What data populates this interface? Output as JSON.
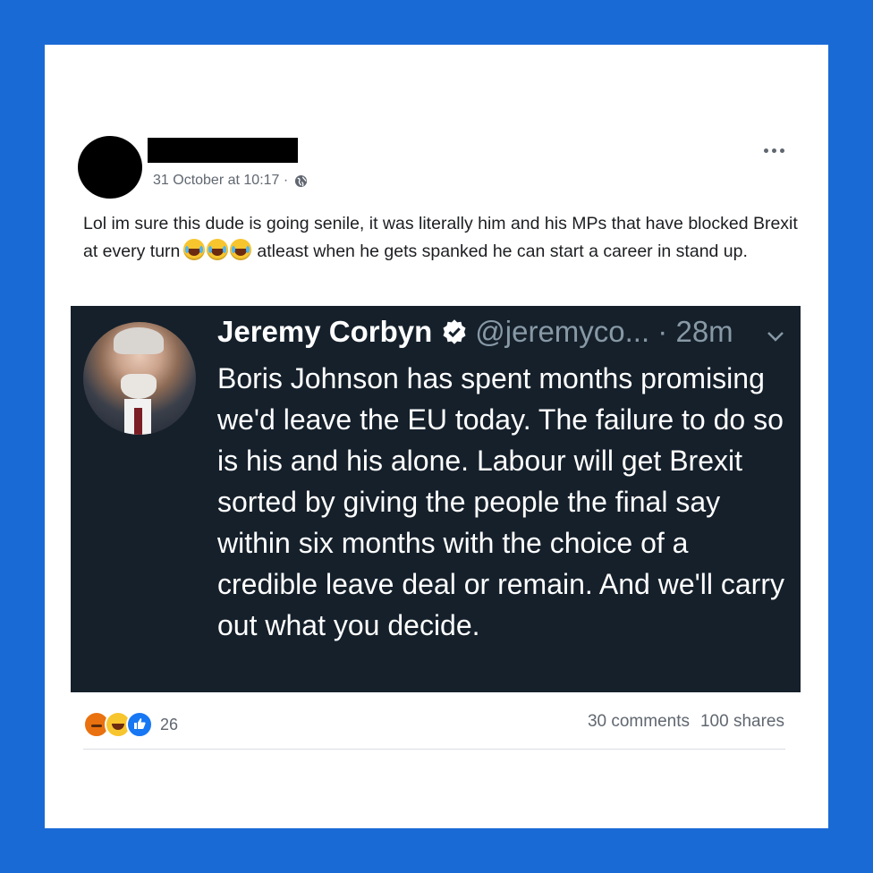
{
  "post": {
    "timestamp": "31 October at 10:17 ·",
    "text_part1": "Lol im sure this dude is going senile, it was literally him and his MPs that have blocked Brexit at every turn",
    "text_part2": "atleast when he gets spanked he can start a career in stand up.",
    "emoji_icons": [
      "face-with-tears-of-joy",
      "face-with-tears-of-joy",
      "face-with-tears-of-joy"
    ]
  },
  "tweet": {
    "name": "Jeremy Corbyn",
    "handle": "@jeremyco... · 28m",
    "body": "Boris Johnson has spent months promising we'd leave the EU today. The failure to do so is his and his alone. Labour will get Brexit sorted by giving the people the final say within six months with the choice of a credible leave deal or remain. And we'll carry out what you decide."
  },
  "footer": {
    "reaction_icons": [
      "angry-react",
      "haha-react",
      "like-react"
    ],
    "reaction_count": "26",
    "comments": "30 comments",
    "shares": "100 shares"
  },
  "colors": {
    "page_background": "#1a6ad6",
    "tweet_background": "#15202b",
    "meta_text": "#606770",
    "handle_text": "#8899a6"
  }
}
